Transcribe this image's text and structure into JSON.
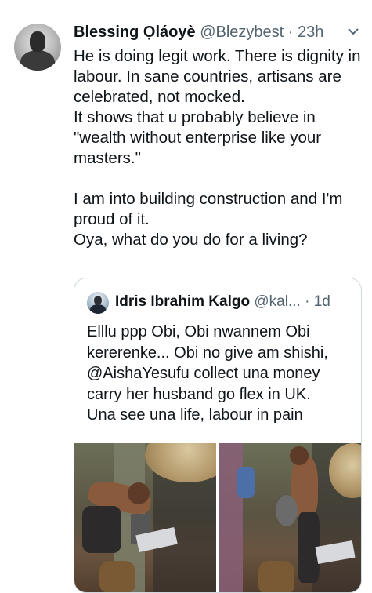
{
  "tweet": {
    "author_name": "Blessing Ọláoyè",
    "handle": "@Blezybest",
    "separator": " · ",
    "time": "23h",
    "lines": [
      "He is doing legit work. There is dignity in labour. In sane countries, artisans are celebrated, not mocked.",
      "It shows that u probably believe in \"wealth without enterprise like your masters.\"",
      "",
      "I am into building construction and I'm proud of it.",
      "Oya, what do you do for a living?"
    ]
  },
  "quoted": {
    "author_name": "Idris Ibrahim Kalgo",
    "handle": "@kal...",
    "separator": " · ",
    "time": "1d",
    "lines": [
      "Elllu ppp Obi, Obi nwannem Obi kererenke... Obi no give am shishi, @AishaYesufu collect una money carry her husband go flex in UK.",
      "Una see una life, labour in pain"
    ]
  },
  "icons": {
    "more": "chevron-down-icon"
  },
  "colors": {
    "text": "#0f1419",
    "secondary": "#536471",
    "border": "#cfd9de"
  }
}
